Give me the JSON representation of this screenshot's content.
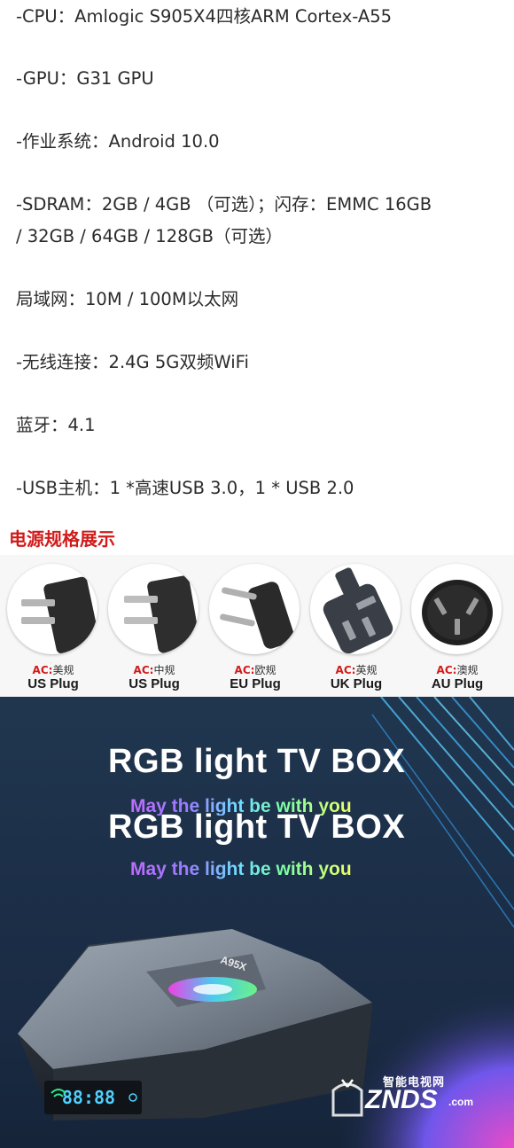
{
  "specs": [
    "-CPU：Amlogic S905X4四核ARM Cortex-A55",
    "-GPU：G31 GPU",
    "-作业系统：Android 10.0",
    "-SDRAM：2GB / 4GB （可选）；闪存：EMMC 16GB",
    "/ 32GB / 64GB / 128GB（可选）",
    "局域网：10M / 100M以太网",
    "-无线连接：2.4G 5G双频WiFi",
    "蓝牙：4.1",
    "-USB主机：1 *高速USB 3.0，1 * USB 2.0"
  ],
  "power_section": {
    "title": "电源规格展示",
    "plugs": [
      {
        "ac_prefix": "AC:",
        "ac_label": "美规",
        "name": "US Plug"
      },
      {
        "ac_prefix": "AC:",
        "ac_label": "中规",
        "name": "US Plug"
      },
      {
        "ac_prefix": "AC:",
        "ac_label": "欧规",
        "name": "EU Plug"
      },
      {
        "ac_prefix": "AC:",
        "ac_label": "英规",
        "name": "UK Plug"
      },
      {
        "ac_prefix": "AC:",
        "ac_label": "澳规",
        "name": "AU Plug"
      }
    ]
  },
  "banner": {
    "headline": "RGB  light TV BOX",
    "tagline": "May the light be with you",
    "box_display": "88:88",
    "box_brand": "A95X"
  },
  "watermark": {
    "cn": "智能电视网",
    "en": "ZNDS",
    "suffix": ".com"
  },
  "colors": {
    "section_title": "#d11b1b",
    "banner_bg": "#1d3049",
    "box_display": "#4fd0ff"
  }
}
